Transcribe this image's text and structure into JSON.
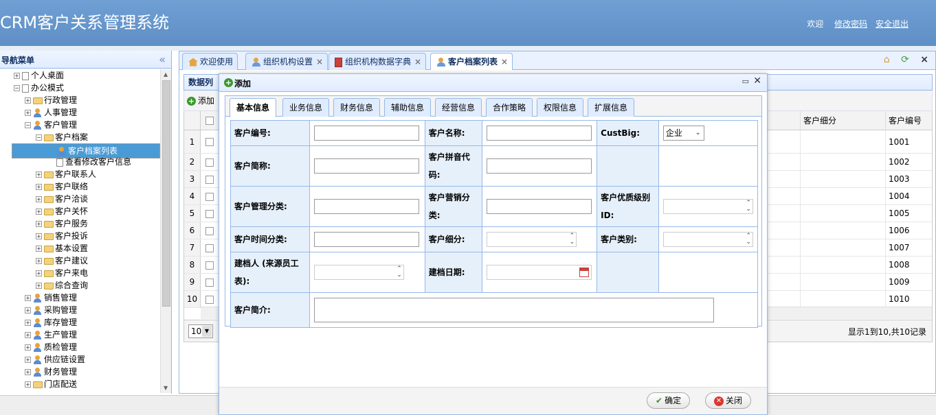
{
  "header": {
    "title": "CRM客户关系管理系统",
    "welcome": "欢迎",
    "change_password": "修改密码",
    "logout": "安全退出"
  },
  "sidebar": {
    "title": "导航菜单",
    "collapse_glyph": "«",
    "tree": [
      {
        "label": "个人桌面",
        "icon": "desk-icon"
      },
      {
        "label": "办公模式",
        "icon": "desk-icon"
      },
      {
        "label": "行政管理",
        "icon": "folder-icon"
      },
      {
        "label": "人事管理",
        "icon": "people-icon"
      },
      {
        "label": "客户管理",
        "icon": "people-icon"
      },
      {
        "label": "客户档案",
        "icon": "folder-icon"
      },
      {
        "label": "客户档案列表",
        "icon": "user-icon",
        "selected": true
      },
      {
        "label": "查看修改客户信息",
        "icon": "document-icon"
      },
      {
        "label": "客户联系人",
        "icon": "folder-icon"
      },
      {
        "label": "客户联络",
        "icon": "folder-icon"
      },
      {
        "label": "客户洽谈",
        "icon": "folder-icon"
      },
      {
        "label": "客户关怀",
        "icon": "folder-icon"
      },
      {
        "label": "客户服务",
        "icon": "folder-icon"
      },
      {
        "label": "客户投诉",
        "icon": "folder-icon"
      },
      {
        "label": "基本设置",
        "icon": "folder-icon"
      },
      {
        "label": "客户建议",
        "icon": "folder-icon"
      },
      {
        "label": "客户来电",
        "icon": "folder-icon"
      },
      {
        "label": "综合查询",
        "icon": "folder-icon"
      },
      {
        "label": "销售管理",
        "icon": "people-icon"
      },
      {
        "label": "采购管理",
        "icon": "people-icon"
      },
      {
        "label": "库存管理",
        "icon": "people-icon"
      },
      {
        "label": "生产管理",
        "icon": "people-icon"
      },
      {
        "label": "质检管理",
        "icon": "people-icon"
      },
      {
        "label": "供应链设置",
        "icon": "people-icon"
      },
      {
        "label": "财务管理",
        "icon": "people-icon"
      },
      {
        "label": "门店配送",
        "icon": "folder-icon"
      }
    ]
  },
  "tabs": [
    {
      "label": "欢迎使用",
      "icon": "home-icon",
      "closable": false
    },
    {
      "label": "组织机构设置",
      "icon": "org-icon",
      "closable": true
    },
    {
      "label": "组织机构数据字典",
      "icon": "book-icon",
      "closable": true
    },
    {
      "label": "客户档案列表",
      "icon": "user-icon",
      "closable": true,
      "active": true
    }
  ],
  "datagrid": {
    "title": "数据列",
    "add_label": "添加",
    "columns": [
      "客户细分",
      "客户编号"
    ],
    "row_numbers": [
      "1",
      "2",
      "3",
      "4",
      "5",
      "6",
      "7",
      "8",
      "9",
      "10"
    ],
    "customer_codes": [
      "1001",
      "1002",
      "1003",
      "1004",
      "1005",
      "1006",
      "1007",
      "1008",
      "1009",
      "1010"
    ],
    "page_size": "10",
    "page_info": "显示1到10,共10记录"
  },
  "dialog": {
    "title": "添加",
    "tabs": [
      "基本信息",
      "业务信息",
      "财务信息",
      "辅助信息",
      "经营信息",
      "合作策略",
      "权限信息",
      "扩展信息"
    ],
    "active_tab": "基本信息",
    "labels": {
      "customer_code": "客户编号:",
      "customer_name": "客户名称:",
      "custbig": "CustBig:",
      "short_name_1": "客户简称:",
      "pinyin_1": "客户拼音代",
      "pinyin_2": "码:",
      "mgmt_class": "客户管理分类:",
      "marketing_1": "客户营销分",
      "marketing_2": "类:",
      "quality_1": "客户优质级别",
      "quality_2": "ID:",
      "time_class": "客户时间分类:",
      "segment": "客户细分:",
      "category": "客户类别:",
      "creator_1": "建档人 (来源员工",
      "creator_2": "表):",
      "create_date": "建档日期:",
      "intro": "客户简介:"
    },
    "custbig_value": "企业",
    "ok_label": "确定",
    "close_label": "关闭"
  }
}
